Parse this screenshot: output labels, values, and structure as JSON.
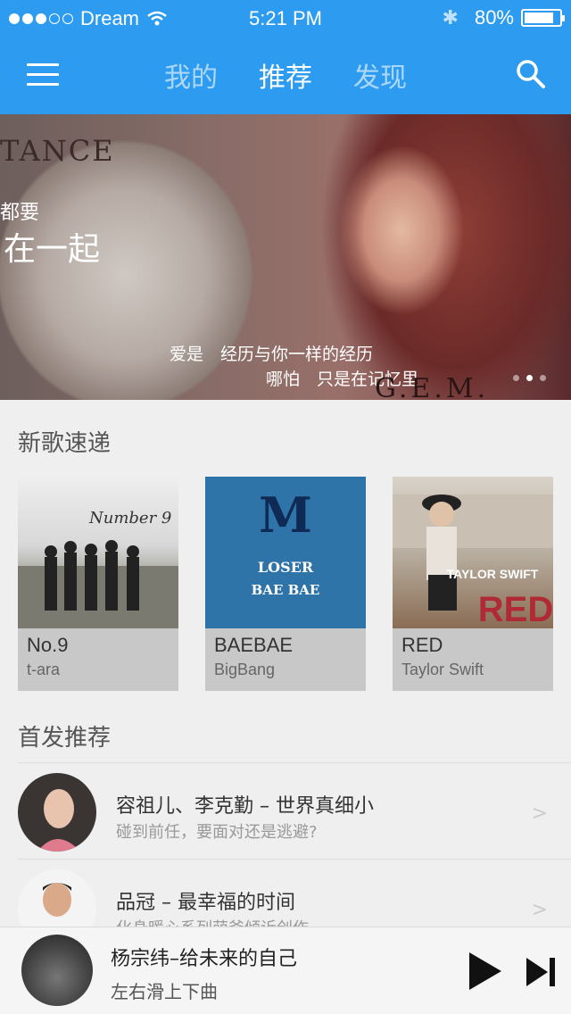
{
  "status_bar": {
    "carrier": "Dream",
    "time": "5:21 PM",
    "battery": "80%",
    "battery_level": 0.8,
    "icons": [
      "signal-dots-icon",
      "wifi-icon",
      "bluetooth-icon",
      "battery-icon"
    ]
  },
  "nav": {
    "menu_icon": "hamburger-icon",
    "tabs": [
      {
        "label": "我的",
        "active": false
      },
      {
        "label": "推荐",
        "active": true
      },
      {
        "label": "发现",
        "active": false
      }
    ],
    "search_icon": "search-icon"
  },
  "banner": {
    "brand_text": "TANCE",
    "line1": "都要",
    "line2": "在一起",
    "caption1": "爱是　经历与你一样的经历",
    "caption2": "哪怕　只是在记忆里",
    "signature": "G.E.M.",
    "pages": 3,
    "current_page": 2
  },
  "new_songs": {
    "title": "新歌速递",
    "items": [
      {
        "title": "No.9",
        "artist": "t-ara",
        "art_text": "Number 9"
      },
      {
        "title": "BAEBAE",
        "artist": "BigBang",
        "art_text": "M",
        "art_line1": "LOSER",
        "art_line2": "BAE BAE"
      },
      {
        "title": "RED",
        "artist": "Taylor Swift",
        "art_text": "TAYLOR SWIFT",
        "art_line1": "RED"
      }
    ]
  },
  "premiere": {
    "title": "首发推荐",
    "items": [
      {
        "title": "容祖儿、李克勤 – 世界真细小",
        "subtitle": "碰到前任，要面对还是逃避?"
      },
      {
        "title": "品冠 – 最幸福的时间",
        "subtitle": "化身暖心系列萌爸倾诉创作"
      }
    ]
  },
  "player": {
    "song": "杨宗纬–给未来的自己",
    "hint": "左右滑上下曲",
    "play_icon": "play-icon",
    "next_icon": "next-icon"
  },
  "colors": {
    "header_blue": "#2d9cf0",
    "background": "#efefef",
    "card_caption": "#c8c8c8"
  }
}
